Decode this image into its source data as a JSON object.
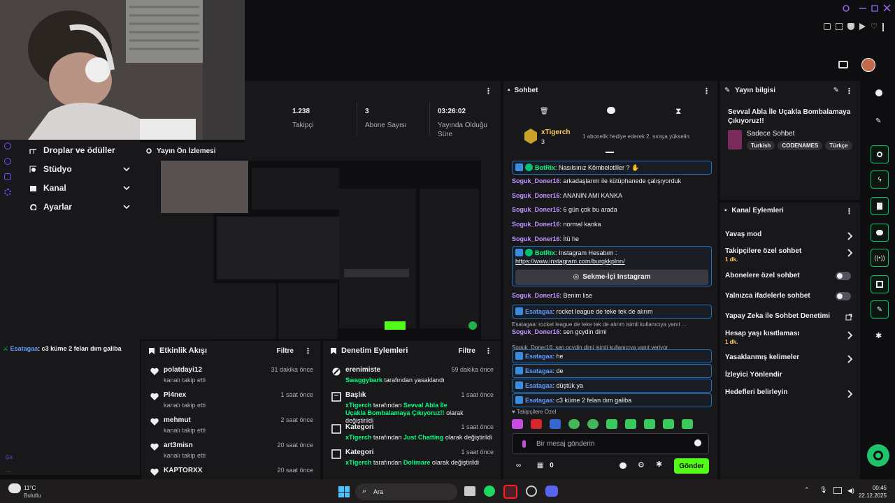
{
  "stats": [
    {
      "value": "1.238",
      "label": "Takipçi"
    },
    {
      "value": "3",
      "label": "Abone Sayısı"
    },
    {
      "value": "03:26:02",
      "label": "Yayında Olduğu Süre"
    }
  ],
  "leftnav": {
    "items": [
      {
        "label": "Droplar ve ödüller"
      },
      {
        "label": "Stüdyo"
      },
      {
        "label": "Kanal"
      },
      {
        "label": "Ayarlar"
      }
    ]
  },
  "overlay_chat": {
    "user": "Esatagaa",
    "message": ": c3 küme 2 felan dım galiba"
  },
  "preview": {
    "title": "Yayın Ön İzlemesi"
  },
  "activity": {
    "title": "Etkinlik Akışı",
    "filter": "Filtre",
    "rows": [
      {
        "name": "polatdayi12",
        "sub": "kanalı takip etti",
        "time": "31 dakika önce"
      },
      {
        "name": "Pl4nex",
        "sub": "kanalı takip etti",
        "time": "1 saat önce"
      },
      {
        "name": "mehmut",
        "sub": "kanalı takip etti",
        "time": "2 saat önce"
      },
      {
        "name": "art3misn",
        "sub": "kanalı takip etti",
        "time": "20 saat önce"
      },
      {
        "name": "KAPTORXX",
        "sub": "",
        "time": "20 saat önce"
      }
    ]
  },
  "moderation": {
    "title": "Denetim Eylemleri",
    "filter": "Filtre",
    "rows": [
      {
        "name": "erenimiste",
        "by": "Swaggybark",
        "text": " tarafından yasaklandı",
        "time": "59 dakika önce"
      },
      {
        "name": "Başlık",
        "by": "xTigerch",
        "text": " tarafından ",
        "value": "Sevval Abla İle Uçakla Bombalamaya Çıkıyoruz!!",
        "text2": " olarak değiştirildi",
        "time": "1 saat önce"
      },
      {
        "name": "Kategori",
        "by": "xTigerch",
        "text": " tarafından ",
        "value": "Just Chatting",
        "text2": " olarak değiştirildi",
        "time": "1 saat önce"
      },
      {
        "name": "Kategori",
        "by": "xTigerch",
        "text": " tarafından ",
        "value": "Dolimare",
        "text2": " olarak değiştirildi",
        "time": "1 saat önce"
      }
    ]
  },
  "chat": {
    "title": "Sohbet",
    "hype": {
      "user": "xTigerch",
      "count": "3",
      "text": "1 abonelik hediye ederek 2. sıraya yükselin"
    },
    "messages": [
      {
        "user": "BotRix",
        "text": ": Nasılsınız Kömbelotlller ? ✋",
        "bot": true
      },
      {
        "user": "Soguk_Doner16",
        "text": ": arkadaşlarım ile kütüphanede çalışıyorduk"
      },
      {
        "user": "Soguk_Doner16",
        "text": ": ANANIN AMI KANKA"
      },
      {
        "user": "Soguk_Doner16",
        "text": ": 6 gün çok bu arada"
      },
      {
        "user": "Soguk_Doner16",
        "text": ": normal kanka"
      },
      {
        "user": "Soguk_Doner16",
        "text": ": İtü he"
      }
    ],
    "bot_insta": {
      "user": "BotRix",
      "text": ": Instagram Hesabım :",
      "link": "https://www.instagram.com/burqkkplnn/",
      "button": "Sekme-İçi Instagram"
    },
    "messages2": [
      {
        "user": "Soguk_Doner16",
        "text": ": Benim lise"
      },
      {
        "user": "Esatagaa",
        "text": ": rocket league de teke tek de alırım",
        "hl": true
      },
      {
        "reply": "Esatagaa: rocket league de teke tek de alırım isimli kullanıcıya yanıt ..."
      },
      {
        "user": "Soguk_Doner16",
        "text": ": sen gcydin dimi"
      },
      {
        "reply": "Soguk_Doner16: sen gcydin dimi isimli kullanıcıya yanıt veriyor"
      },
      {
        "user": "Esatagaa",
        "text": ": he",
        "hl": true
      },
      {
        "user": "Esatagaa",
        "text": ": de",
        "hl": true
      },
      {
        "user": "Esatagaa",
        "text": ": düştük ya",
        "hl": true
      },
      {
        "user": "Esatagaa",
        "text": ": c3 küme 2 felan dım galiba",
        "hl": true
      }
    ],
    "follower_only": "Takipçilere Özel",
    "input_placeholder": "Bir mesaj gönderin",
    "points": "0",
    "send": "Gönder"
  },
  "stream_info": {
    "title": "Yayın bilgisi",
    "stream_title": "Sevval Abla İle Uçakla Bombalamaya Çıkıyoruz!!",
    "category": "Sadece Sohbet",
    "tags": [
      "Turkish",
      "CODENAMES",
      "Türkçe"
    ]
  },
  "channel_actions": {
    "title": "Kanal Eylemleri",
    "items": [
      {
        "label": "Yavaş mod",
        "type": "chevron"
      },
      {
        "label": "Takipçilere özel sohbet",
        "sub": "1 dk.",
        "type": "chevron"
      },
      {
        "label": "Abonelere özel sohbet",
        "type": "toggle"
      },
      {
        "label": "Yalnızca ifadelerle sohbet",
        "type": "toggle"
      },
      {
        "label": "Yapay Zeka ile Sohbet Denetimi",
        "type": "external"
      },
      {
        "label": "Hesap yaşı kısıtlaması",
        "sub": "1 dk.",
        "type": "chevron"
      },
      {
        "label": "Yasaklanmış kelimeler",
        "type": "chevron"
      },
      {
        "label": "İzleyici Yönlendir",
        "type": "none"
      },
      {
        "label": "Hedefleri belirleyin",
        "type": "chevron"
      }
    ]
  },
  "taskbar": {
    "weather_temp": "11°C",
    "weather_desc": "Bulutlu",
    "search": "Ara",
    "time": "00:45",
    "date": "22.12.2025"
  },
  "colors": {
    "accent": "#53fc18",
    "bg": "#0e0e10",
    "panel": "#18181b",
    "username": "#bf94ff",
    "link_green": "#00ff80"
  }
}
